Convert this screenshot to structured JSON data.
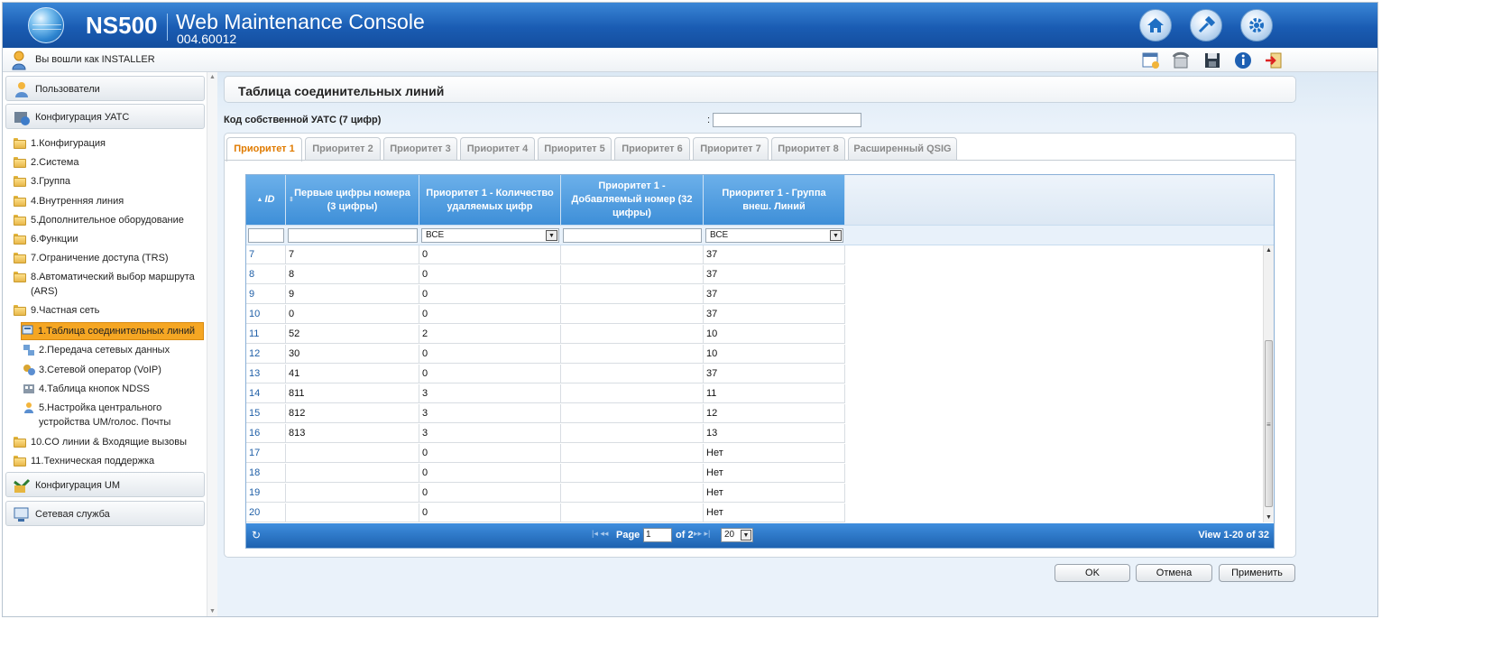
{
  "banner": {
    "product": "NS500",
    "title": "Web Maintenance Console",
    "version": "004.60012"
  },
  "toolbar": {
    "login_text": "Вы вошли как INSTALLER"
  },
  "sidebar": {
    "sections": {
      "users": "Пользователи",
      "pbx_config": "Конфигурация УАТС",
      "um_config": "Конфигурация UM",
      "network_service": "Сетевая служба"
    },
    "items": [
      "1.Конфигурация",
      "2.Система",
      "3.Группа",
      "4.Внутренняя линия",
      "5.Дополнительное оборудование",
      "6.Функции",
      "7.Ограничение доступа (TRS)",
      "8.Автоматический выбор маршрута (ARS)",
      "9.Частная сеть",
      "10.CO линии & Входящие вызовы",
      "11.Техническая поддержка"
    ],
    "subitems": [
      "1.Таблица соединительных линий",
      "2.Передача сетевых данных",
      "3.Сетевой оператор (VoIP)",
      "4.Таблица кнопок NDSS",
      "5.Настройка центрального устройства UM/голос. Почты"
    ]
  },
  "content": {
    "page_title": "Таблица соединительных линий",
    "code_label": "Код собственной УАТС (7 цифр)",
    "code_value": ""
  },
  "tabs": [
    "Приоритет 1",
    "Приоритет 2",
    "Приоритет 3",
    "Приоритет 4",
    "Приоритет 5",
    "Приоритет 6",
    "Приоритет 7",
    "Приоритет 8",
    "Расширенный QSIG"
  ],
  "active_tab": "Приоритет 1",
  "grid": {
    "columns": [
      "ID",
      "Первые цифры номера (3 цифры)",
      "Приоритет 1 - Количество удаляемых цифр",
      "Приоритет 1 - Добавляемый номер (32 цифры)",
      "Приоритет 1 - Группа внеш. Линий"
    ],
    "filter_delete": "ВСЕ",
    "filter_group": "ВСЕ",
    "rows": [
      {
        "id": "7",
        "first": "7",
        "del": "0",
        "add": "",
        "group": "37"
      },
      {
        "id": "8",
        "first": "8",
        "del": "0",
        "add": "",
        "group": "37"
      },
      {
        "id": "9",
        "first": "9",
        "del": "0",
        "add": "",
        "group": "37"
      },
      {
        "id": "10",
        "first": "0",
        "del": "0",
        "add": "",
        "group": "37"
      },
      {
        "id": "11",
        "first": "52",
        "del": "2",
        "add": "",
        "group": "10"
      },
      {
        "id": "12",
        "first": "30",
        "del": "0",
        "add": "",
        "group": "10"
      },
      {
        "id": "13",
        "first": "41",
        "del": "0",
        "add": "",
        "group": "37"
      },
      {
        "id": "14",
        "first": "811",
        "del": "3",
        "add": "",
        "group": "11"
      },
      {
        "id": "15",
        "first": "812",
        "del": "3",
        "add": "",
        "group": "12"
      },
      {
        "id": "16",
        "first": "813",
        "del": "3",
        "add": "",
        "group": "13"
      },
      {
        "id": "17",
        "first": "",
        "del": "0",
        "add": "",
        "group": "Нет"
      },
      {
        "id": "18",
        "first": "",
        "del": "0",
        "add": "",
        "group": "Нет"
      },
      {
        "id": "19",
        "first": "",
        "del": "0",
        "add": "",
        "group": "Нет"
      },
      {
        "id": "20",
        "first": "",
        "del": "0",
        "add": "",
        "group": "Нет"
      }
    ]
  },
  "pager": {
    "page_label": "Page",
    "page_value": "1",
    "of_text": "of 2",
    "page_size": "20",
    "view_text": "View 1-20 of 32"
  },
  "buttons": {
    "ok": "OK",
    "cancel": "Отмена",
    "apply": "Применить"
  },
  "colors": {
    "banner": "#1a5cb3",
    "active_tab_text": "#e07b00",
    "active_nav": "#f5a623",
    "grid_header": "#3e8fd8"
  },
  "icons": {
    "home": "home-icon",
    "tools": "tools-icon",
    "settings": "gear-icon"
  }
}
